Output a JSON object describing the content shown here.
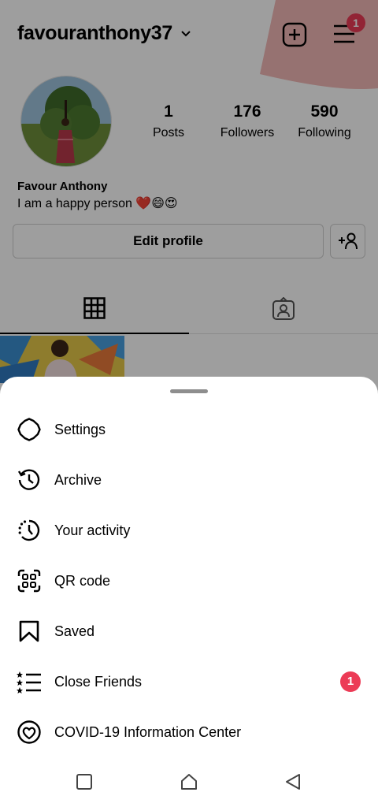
{
  "profile": {
    "username": "favouranthony37",
    "menu_badge": "1",
    "full_name": "Favour Anthony",
    "bio": "I am a happy person ❤️😄😍",
    "stats": {
      "posts_count": "1",
      "posts_label": "Posts",
      "followers_count": "176",
      "followers_label": "Followers",
      "following_count": "590",
      "following_label": "Following"
    },
    "edit_profile_label": "Edit profile"
  },
  "menu": {
    "items": [
      {
        "label": "Settings",
        "icon": "settings-icon"
      },
      {
        "label": "Archive",
        "icon": "archive-icon"
      },
      {
        "label": "Your activity",
        "icon": "activity-icon"
      },
      {
        "label": "QR code",
        "icon": "qr-code-icon"
      },
      {
        "label": "Saved",
        "icon": "bookmark-icon"
      },
      {
        "label": "Close Friends",
        "icon": "close-friends-icon",
        "badge": "1"
      },
      {
        "label": "COVID-19 Information Center",
        "icon": "covid-heart-icon"
      }
    ]
  },
  "colors": {
    "badge": "#ec3b56",
    "accent_pink": "#f2b9b6"
  }
}
